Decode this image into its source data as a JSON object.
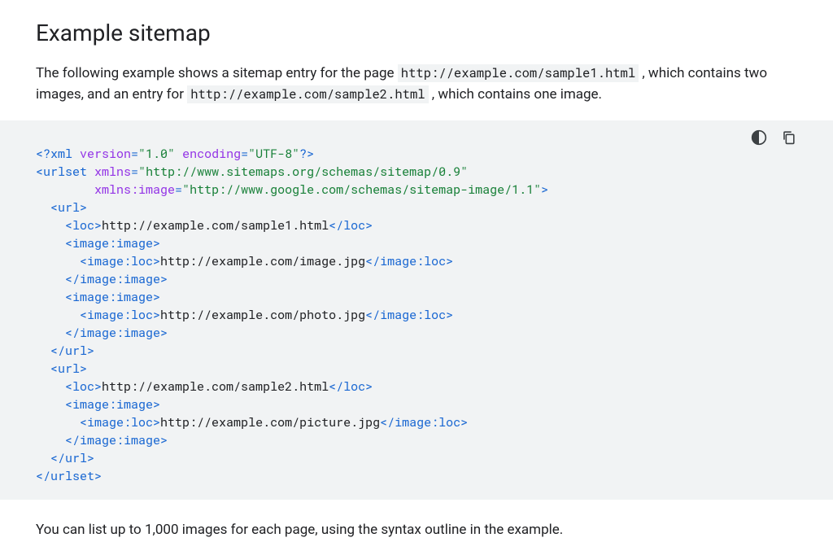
{
  "heading": "Example sitemap",
  "intro": {
    "prefix": "The following example shows a sitemap entry for the page ",
    "code1": "http://example.com/sample1.html",
    "mid": " , which contains two images, and an entry for ",
    "code2": "http://example.com/sample2.html",
    "suffix": " , which contains one image."
  },
  "code": {
    "xml_decl_open": "<?xml ",
    "xml_attr1_name": "version",
    "xml_attr1_val": "\"1.0\"",
    "xml_attr2_name": "encoding",
    "xml_attr2_val": "\"UTF-8\"",
    "xml_decl_close": "?>",
    "urlset_open": "<urlset",
    "xmlns": "xmlns",
    "xmlns_val": "\"http://www.sitemaps.org/schemas/sitemap/0.9\"",
    "xmlns_image": "xmlns:image",
    "xmlns_image_val": "\"http://www.google.com/schemas/sitemap-image/1.1\"",
    "gt": ">",
    "url_open": "<url>",
    "url_close": "</url>",
    "loc_open": "<loc>",
    "loc_close": "</loc>",
    "loc1": "http://example.com/sample1.html",
    "image_open": "<image:image>",
    "image_close": "</image:image>",
    "imgloc_open": "<image:loc>",
    "imgloc_close": "</image:loc>",
    "img1": "http://example.com/image.jpg",
    "img2": "http://example.com/photo.jpg",
    "loc2": "http://example.com/sample2.html",
    "img3": "http://example.com/picture.jpg",
    "urlset_close": "</urlset>"
  },
  "footer": "You can list up to 1,000 images for each page, using the syntax outline in the example."
}
